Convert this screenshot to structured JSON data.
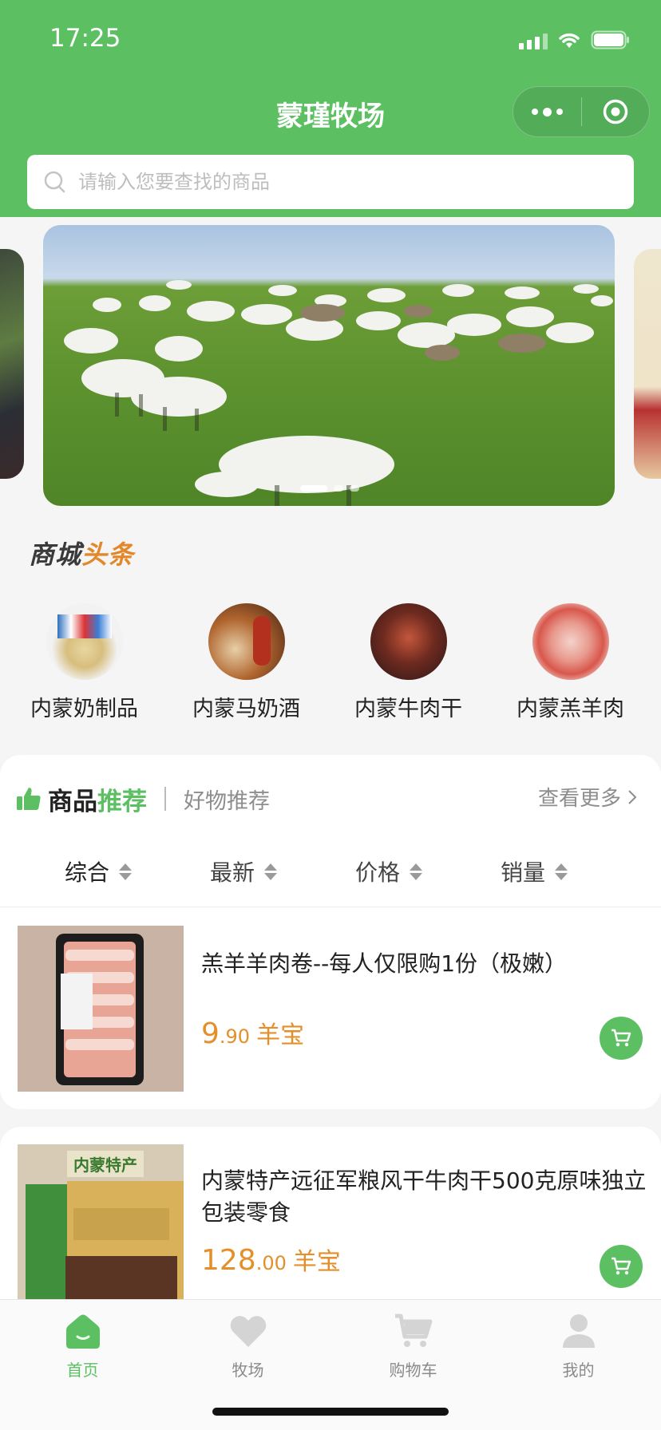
{
  "status_bar": {
    "time": "17:25"
  },
  "nav": {
    "title": "蒙瑾牧场"
  },
  "search": {
    "placeholder": "请输入您要查找的商品"
  },
  "banner": {
    "slide_count": 3,
    "active_index": 0
  },
  "headline": {
    "part1": "商城",
    "part2": "头条"
  },
  "categories": [
    {
      "label": "内蒙奶制品"
    },
    {
      "label": "内蒙马奶酒"
    },
    {
      "label": "内蒙牛肉干"
    },
    {
      "label": "内蒙羔羊肉"
    }
  ],
  "recommend": {
    "title_a": "商品",
    "title_b": "推荐",
    "subtitle": "好物推荐",
    "more": "查看更多"
  },
  "sort": [
    {
      "label": "综合"
    },
    {
      "label": "最新"
    },
    {
      "label": "价格"
    },
    {
      "label": "销量"
    }
  ],
  "products": [
    {
      "name": "羔羊羊肉卷--每人仅限购1份（极嫩）",
      "price_int": "9",
      "price_dec": ".90",
      "unit": "羊宝"
    },
    {
      "name": "内蒙特产远征军粮风干牛肉干500克原味独立包装零食",
      "price_int": "128",
      "price_dec": ".00",
      "unit": "羊宝",
      "image_caption": "内蒙特产"
    }
  ],
  "tabbar": [
    {
      "label": "首页",
      "icon": "home-icon",
      "active": true
    },
    {
      "label": "牧场",
      "icon": "heart-icon",
      "active": false
    },
    {
      "label": "购物车",
      "icon": "cart-icon",
      "active": false
    },
    {
      "label": "我的",
      "icon": "user-icon",
      "active": false
    }
  ],
  "colors": {
    "brand_green": "#5cc063",
    "price_orange": "#e48f2a"
  }
}
